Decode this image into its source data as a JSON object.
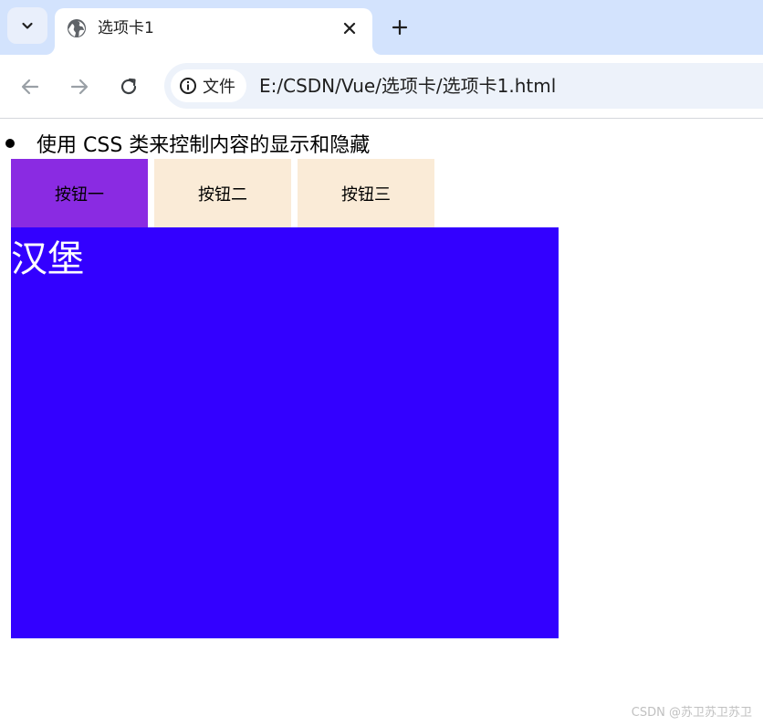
{
  "browser": {
    "tab": {
      "title": "选项卡1",
      "favicon": "globe-icon"
    },
    "address_bar": {
      "site_chip_label": "文件",
      "url": "E:/CSDN/Vue/选项卡/选项卡1.html"
    }
  },
  "page": {
    "bullet_text": "使用 CSS 类来控制内容的显示和隐藏",
    "buttons": [
      {
        "label": "按钮一",
        "active": true
      },
      {
        "label": "按钮二",
        "active": false
      },
      {
        "label": "按钮三",
        "active": false
      }
    ],
    "panel": {
      "text": "汉堡"
    },
    "watermark": "CSDN @苏卫苏卫苏卫"
  },
  "colors": {
    "tabstrip_bg": "#d3e3fd",
    "omnibox_bg": "#edf2fa",
    "active_button_bg": "#8a2be2",
    "inactive_button_bg": "#faebd7",
    "panel_bg": "#3300ff",
    "panel_text": "#ffffff"
  }
}
